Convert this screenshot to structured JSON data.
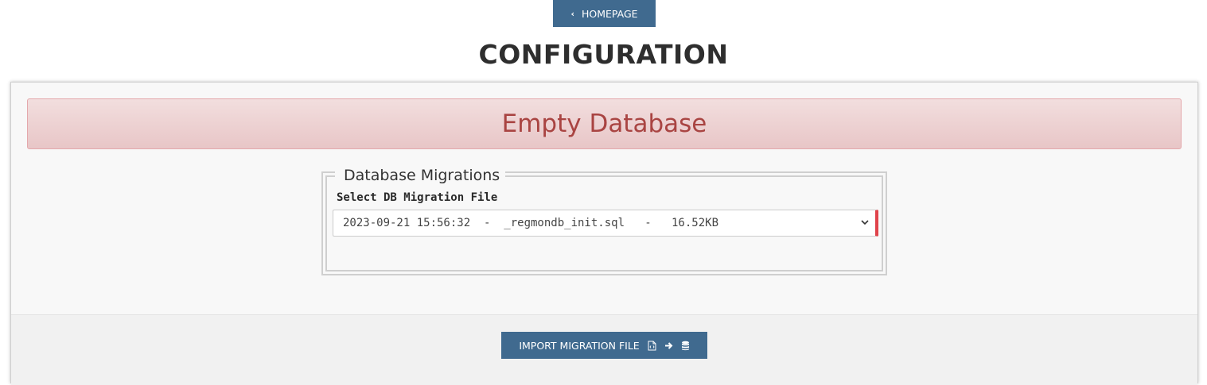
{
  "nav": {
    "back_icon": "chevron-left-icon",
    "home_label": "HOMEPAGE"
  },
  "page": {
    "title": "CONFIGURATION"
  },
  "alert": {
    "text": "Empty Database",
    "color": "#a94442"
  },
  "migrations": {
    "legend": "Database Migrations",
    "label": "Select DB Migration File",
    "selected_value": "2023-09-21 15:56:32  -  _regmondb_init.sql   -   16.52KB"
  },
  "actions": {
    "import_label": "IMPORT MIGRATION FILE",
    "icons": [
      "file-code-icon",
      "arrow-right-icon",
      "database-icon"
    ]
  },
  "colors": {
    "button_bg": "#406a8f",
    "validation_border": "#e0434b"
  }
}
